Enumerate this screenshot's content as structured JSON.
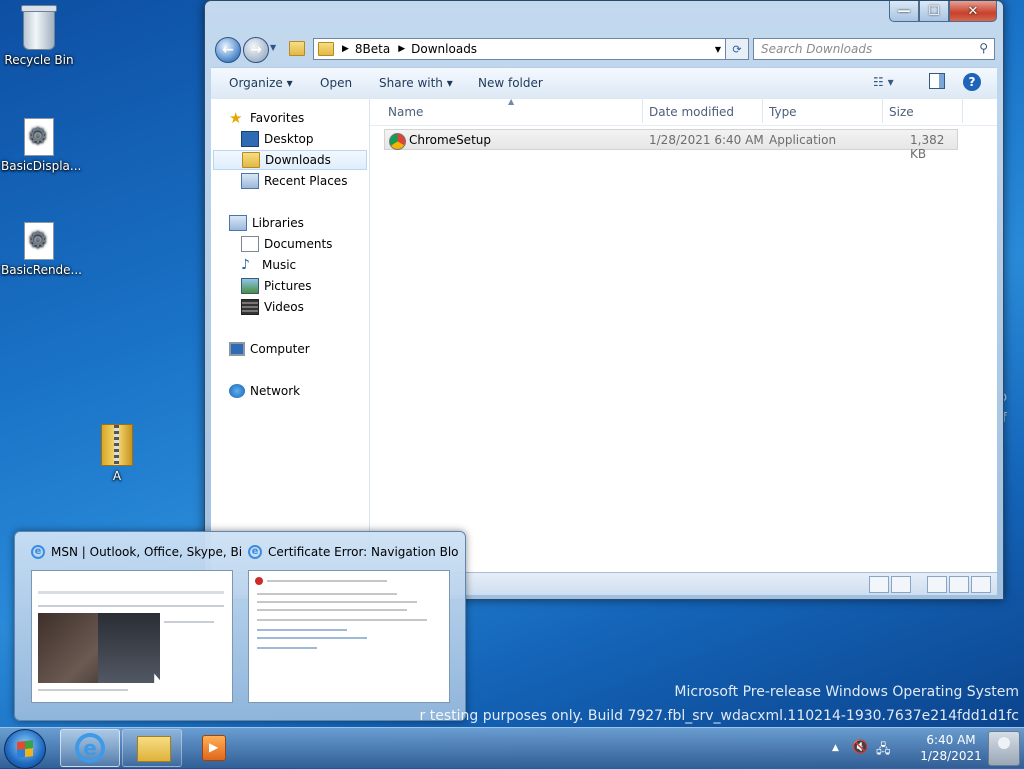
{
  "desktop": {
    "icons": [
      {
        "label": "Recycle Bin"
      },
      {
        "label": "BasicDispla..."
      },
      {
        "label": "BasicRende..."
      },
      {
        "label": "A"
      }
    ],
    "clipped_text": [
      "to",
      "of"
    ],
    "watermark": {
      "line1": "Microsoft Pre-release Windows Operating System",
      "line2": "r testing purposes only. Build 7927.fbl_srv_wdacxml.110214-1930.7637e214fdd1d1fc"
    }
  },
  "explorer": {
    "caption_buttons": {
      "minimize": "—",
      "maximize": "☐",
      "close": "✕"
    },
    "nav": {
      "back": "←",
      "forward": "→"
    },
    "address": {
      "crumbs": [
        "8Beta",
        "Downloads"
      ],
      "separator": "▶",
      "dropdown": "▼"
    },
    "refresh_icon": "⟳",
    "search": {
      "placeholder": "Search Downloads",
      "icon": "⚲"
    },
    "toolbar": {
      "organize": "Organize ▾",
      "open": "Open",
      "share_with": "Share with ▾",
      "new_folder": "New folder",
      "views_icon": "☷ ▾",
      "help": "?"
    },
    "nav_pane": {
      "favorites_header": "Favorites",
      "favorites": [
        "Desktop",
        "Downloads",
        "Recent Places"
      ],
      "libraries_header": "Libraries",
      "libraries": [
        "Documents",
        "Music",
        "Pictures",
        "Videos"
      ],
      "computer": "Computer",
      "network": "Network",
      "selected": "Downloads"
    },
    "columns": {
      "name": "Name",
      "date_modified": "Date modified",
      "type": "Type",
      "size": "Size",
      "sort_indicator": "▲"
    },
    "files": [
      {
        "name": "ChromeSetup",
        "date_modified": "1/28/2021 6:40 AM",
        "type": "Application",
        "size": "1,382 KB"
      }
    ]
  },
  "taskbar_preview": {
    "windows": [
      {
        "title": "MSN | Outlook, Office, Skype, Bi..."
      },
      {
        "title": "Certificate Error: Navigation Blo..."
      }
    ]
  },
  "taskbar": {
    "apps": [
      "Internet Explorer",
      "Windows Explorer",
      "Windows Media Player"
    ],
    "tray": {
      "arrow": "▲",
      "volume": "🔇",
      "network": "🖧"
    },
    "clock": {
      "time": "6:40 AM",
      "date": "1/28/2021"
    }
  }
}
